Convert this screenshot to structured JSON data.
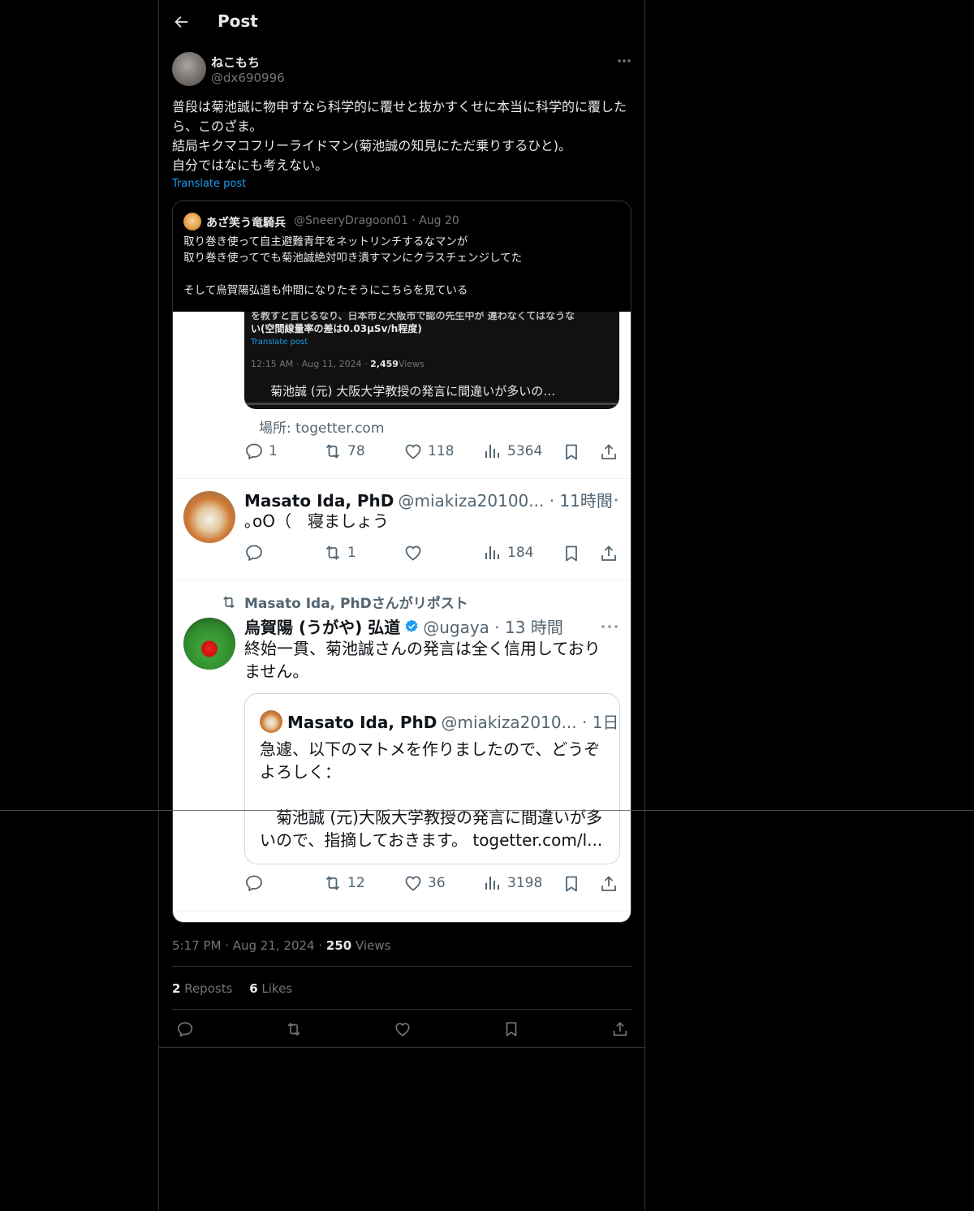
{
  "header": {
    "title": "Post"
  },
  "author": {
    "display_name": "ねこもち",
    "handle": "@dx690996"
  },
  "post": {
    "text": "普段は菊池誠に物申すなら科学的に覆せと抜かすくせに本当に科学的に覆したら、このざま。\n結局キクマコフリーライドマン(菊池誠の知見にただ乗りするひと)。\n自分ではなにも考えない。",
    "translate_label": "Translate post"
  },
  "quoted": {
    "name": "あざ笑う竜騎兵",
    "handle_date": "@SneeryDragoon01 · Aug 20",
    "text": "取り巻き使って自主避難青年をネットリンチするなマンが\n取り巻き使ってでも菊池誠絶対叩き潰すマンにクラスチェンジしてた\n\nそして烏賀陽弘道も仲間になりたそうにこちらを見ている"
  },
  "screenshot": {
    "media_line_1": "を教すと言じるなり、日本市と大阪市で認の先生中が 違わなくてはなうな",
    "media_line_2": "い(空間線量率の差は0.03μSv/h程度)",
    "media_translate": "Translate post",
    "media_time": "12:15 AM · Aug 11, 2024 · ",
    "media_views_count": "2,459",
    "media_views_label": "Views",
    "media_caption": "菊池誠 (元) 大阪大学教授の発言に間違いが多いの…",
    "place": "場所: togetter.com",
    "tweet1_stats": {
      "reply": "1",
      "repost": "78",
      "like": "118",
      "views": "5364"
    },
    "tweet2": {
      "name": "Masato Ida, PhD",
      "meta": "@miakiza20100... · 11時間",
      "text": "｡oO（　寝ましょう",
      "stats": {
        "reply": "",
        "repost": "1",
        "like": "",
        "views": "184"
      }
    },
    "tweet3": {
      "repost_label": "Masato Ida, PhDさんがリポスト",
      "name": "烏賀陽 (うがや) 弘道",
      "meta": "@ugaya · 13 時間",
      "text": "終始一貫、菊池誠さんの発言は全く信用しておりません。",
      "inner": {
        "name": "Masato Ida, PhD",
        "meta": "@miakiza2010... · 1日",
        "text": "急遽、以下のマトメを作りましたので、どうぞよろしく：\n\n　菊池誠 (元)大阪大学教授の発言に間違いが多いので、指摘しておきます。 togetter.com/l..."
      },
      "stats": {
        "reply": "",
        "repost": "12",
        "like": "36",
        "views": "3198"
      }
    }
  },
  "footer": {
    "time_date": "5:17 PM · Aug 21, 2024 · ",
    "views_count": "250",
    "views_label": " Views",
    "reposts_count": "2",
    "reposts_label": " Reposts",
    "likes_count": "6",
    "likes_label": " Likes"
  },
  "colors": {
    "background": "#000000",
    "accent": "#1d9bf0",
    "muted": "#71767b",
    "border": "#2f3336",
    "verified": "#1d9bf0"
  },
  "icons": [
    "back-arrow-icon",
    "more-icon",
    "reply-icon",
    "repost-icon",
    "like-icon",
    "views-icon",
    "bookmark-icon",
    "share-icon",
    "verified-icon"
  ]
}
